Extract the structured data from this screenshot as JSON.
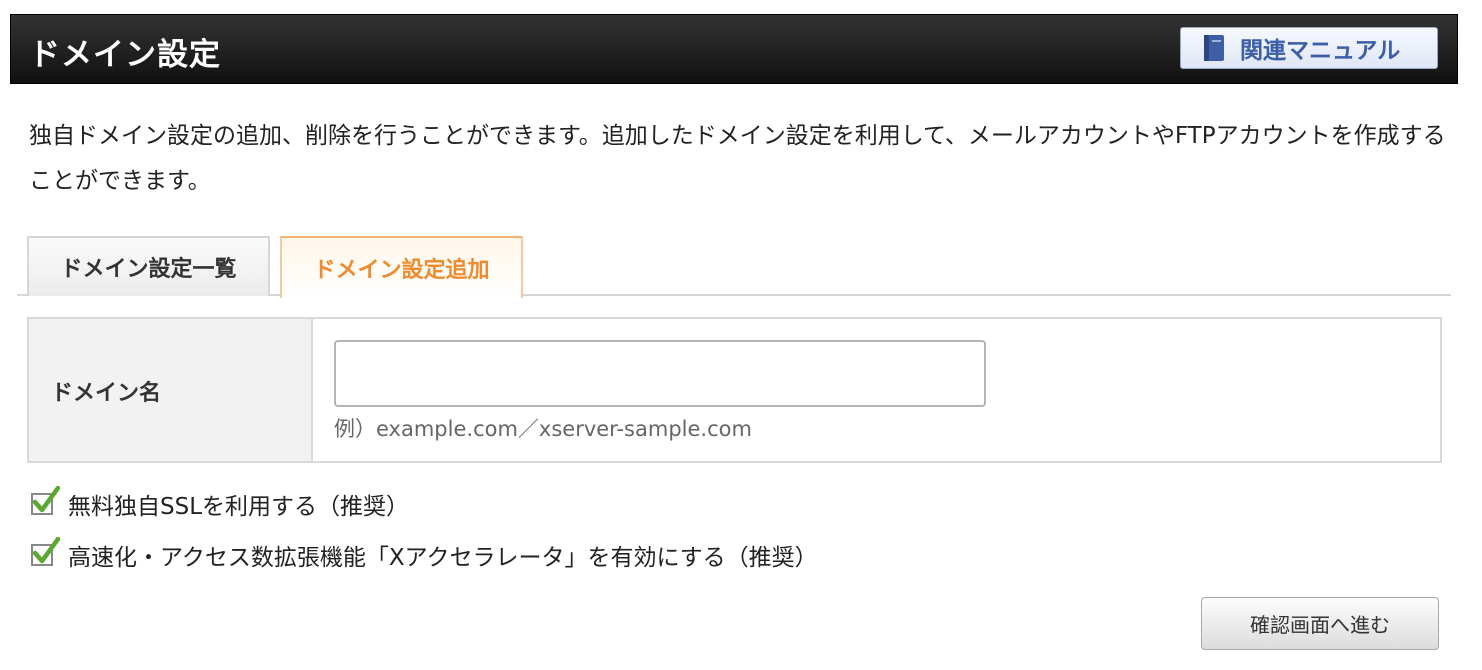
{
  "header": {
    "title": "ドメイン設定",
    "manual_label": "関連マニュアル",
    "manual_icon": "book-icon"
  },
  "description": "独自ドメイン設定の追加、削除を行うことができます。追加したドメイン設定を利用して、メールアカウントやFTPアカウントを作成することができます。",
  "tabs": [
    {
      "label": "ドメイン設定一覧",
      "active": false
    },
    {
      "label": "ドメイン設定追加",
      "active": true
    }
  ],
  "form": {
    "domain_label": "ドメイン名",
    "domain_value": "",
    "domain_hint": "例）example.com／xserver-sample.com"
  },
  "options": [
    {
      "label": "無料独自SSLを利用する（推奨）",
      "checked": true
    },
    {
      "label": "高速化・アクセス数拡張機能「Xアクセラレータ」を有効にする（推奨）",
      "checked": true
    }
  ],
  "submit_label": "確認画面へ進む",
  "colors": {
    "header_bg": "#1a1a1a",
    "active_tab_text": "#ef8a2d",
    "manual_text": "#3b5ea7",
    "check_green": "#5aa832"
  }
}
